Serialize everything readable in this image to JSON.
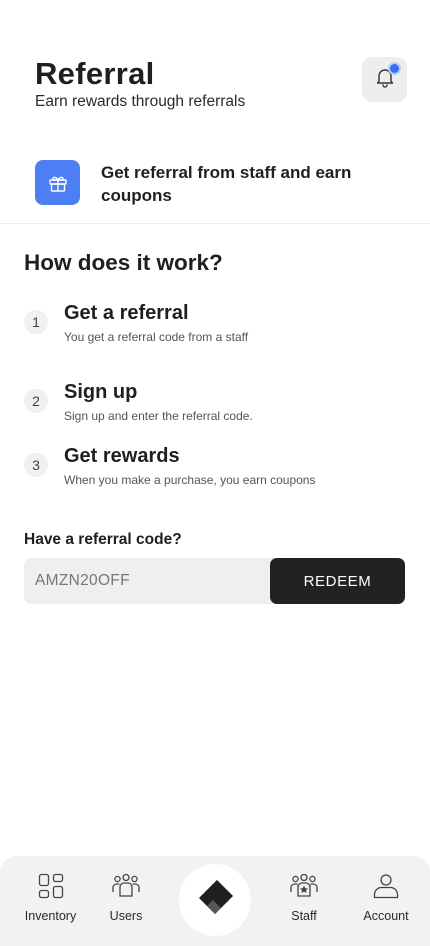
{
  "header": {
    "title": "Referral",
    "subtitle": "Earn rewards through referrals"
  },
  "promo": {
    "text": "Get referral from staff and earn coupons"
  },
  "how": {
    "title": "How does it work?",
    "steps": [
      {
        "number": "1",
        "title": "Get a referral",
        "desc": "You get a referral code from a staff"
      },
      {
        "number": "2",
        "title": "Sign up",
        "desc": "Sign up and enter the referral code."
      },
      {
        "number": "3",
        "title": "Get rewards",
        "desc": "When you make a purchase, you earn coupons"
      }
    ]
  },
  "code": {
    "label": "Have a referral code?",
    "value": "AMZN20OFF",
    "redeem_label": "REDEEM"
  },
  "tabs": [
    {
      "label": "Inventory",
      "icon": "grid-icon"
    },
    {
      "label": "Users",
      "icon": "users-icon"
    },
    {
      "label": "",
      "icon": "home-logo-icon"
    },
    {
      "label": "Staff",
      "icon": "staff-icon"
    },
    {
      "label": "Account",
      "icon": "account-icon"
    }
  ],
  "colors": {
    "accent": "#4e7ef3",
    "notification_dot": "#3b6ef0",
    "button_dark": "#222222"
  }
}
